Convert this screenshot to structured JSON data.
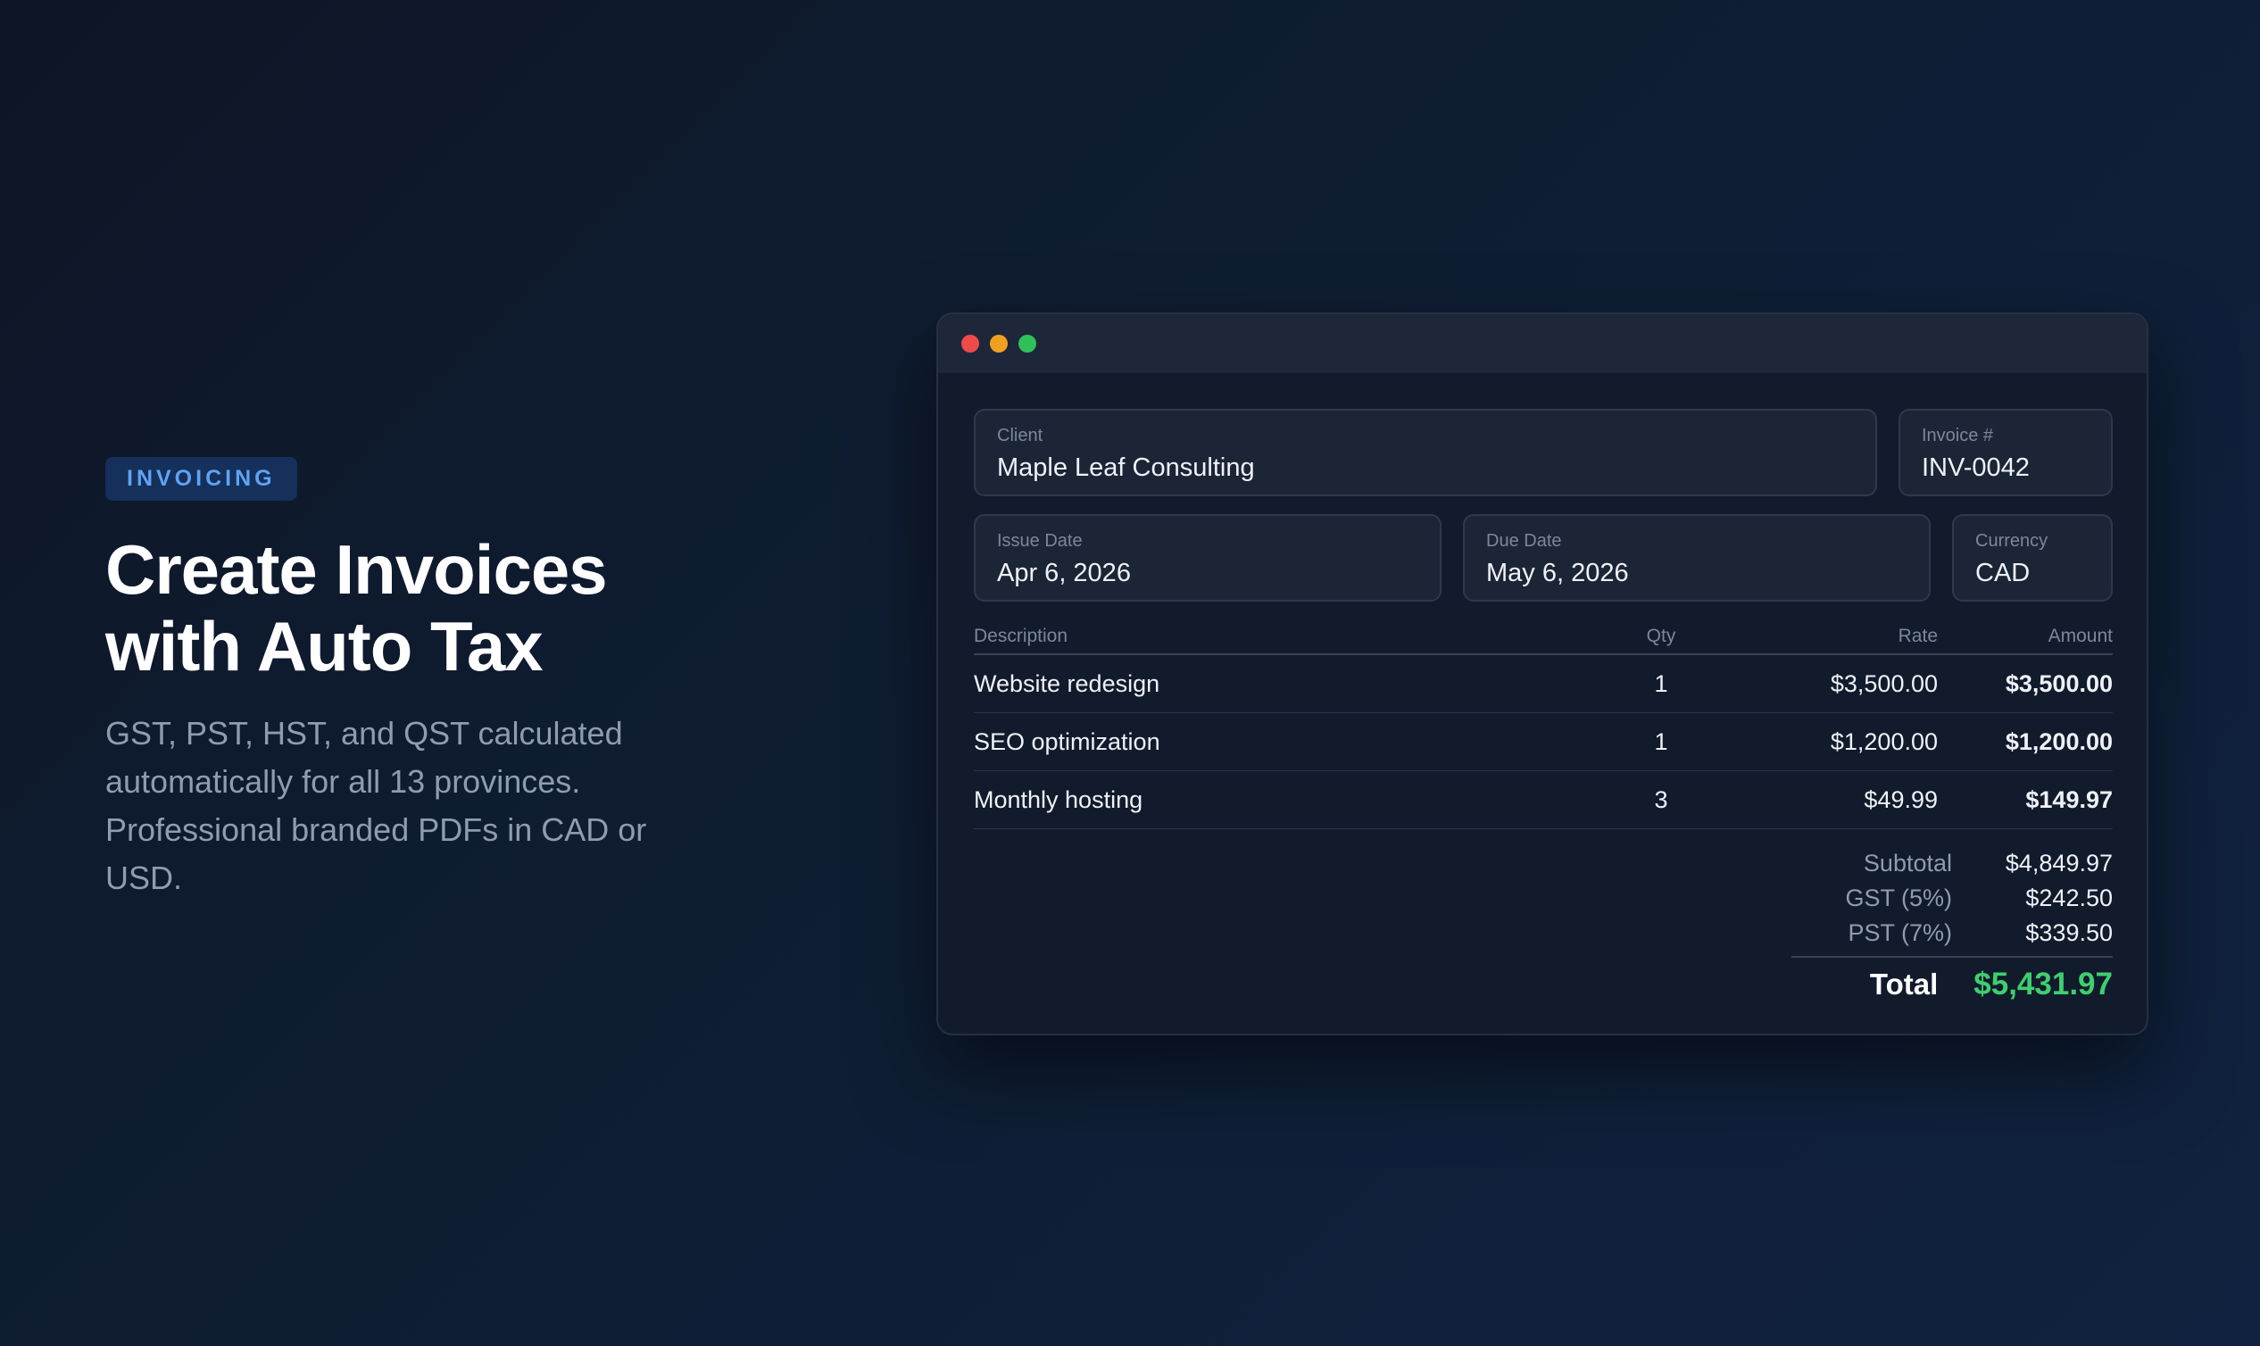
{
  "hero": {
    "badge": "INVOICING",
    "headline_line1": "Create Invoices",
    "headline_line2": "with Auto Tax",
    "description": "GST, PST, HST, and QST calculated automatically for all 13 provinces. Professional branded PDFs in CAD or USD."
  },
  "window": {
    "controls": {
      "close_color": "#ef4a4a",
      "minimize_color": "#f0a020",
      "maximize_color": "#2fc05a"
    },
    "fields": {
      "client": {
        "label": "Client",
        "value": "Maple Leaf Consulting"
      },
      "invoice_number": {
        "label": "Invoice #",
        "value": "INV-0042"
      },
      "issue_date": {
        "label": "Issue Date",
        "value": "Apr 6, 2026"
      },
      "due_date": {
        "label": "Due Date",
        "value": "May 6, 2026"
      },
      "currency": {
        "label": "Currency",
        "value": "CAD"
      }
    },
    "table": {
      "headers": {
        "description": "Description",
        "qty": "Qty",
        "rate": "Rate",
        "amount": "Amount"
      },
      "rows": [
        {
          "description": "Website redesign",
          "qty": "1",
          "rate": "$3,500.00",
          "amount": "$3,500.00"
        },
        {
          "description": "SEO optimization",
          "qty": "1",
          "rate": "$1,200.00",
          "amount": "$1,200.00"
        },
        {
          "description": "Monthly hosting",
          "qty": "3",
          "rate": "$49.99",
          "amount": "$149.97"
        }
      ]
    },
    "totals": {
      "subtotal_label": "Subtotal",
      "subtotal_value": "$4,849.97",
      "gst_label": "GST (5%)",
      "gst_value": "$242.50",
      "pst_label": "PST (7%)",
      "pst_value": "$339.50",
      "total_label": "Total",
      "total_value": "$5,431.97",
      "total_color": "#3ecf6e"
    }
  }
}
